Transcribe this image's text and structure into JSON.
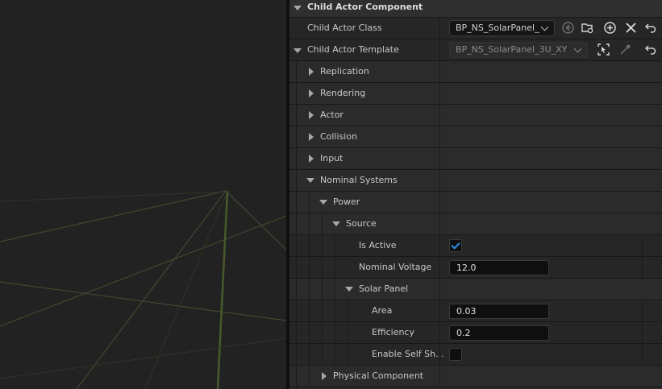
{
  "details": {
    "section_title": "Child Actor Component",
    "child_actor_class": {
      "label": "Child Actor Class",
      "value": "BP_NS_SolarPanel_"
    },
    "child_actor_template": {
      "label": "Child Actor Template",
      "value": "BP_NS_SolarPanel_3U_XY"
    },
    "categories": {
      "replication": "Replication",
      "rendering": "Rendering",
      "actor": "Actor",
      "collision": "Collision",
      "input": "Input",
      "nominal_systems": "Nominal Systems",
      "physical_component": "Physical Component"
    },
    "power": {
      "label": "Power",
      "source": {
        "label": "Source",
        "is_active_label": "Is Active",
        "is_active": true,
        "nominal_voltage_label": "Nominal Voltage",
        "nominal_voltage": "12.0",
        "solar_panel": {
          "label": "Solar Panel",
          "area_label": "Area",
          "area": "0.03",
          "efficiency_label": "Efficiency",
          "efficiency": "0.2",
          "self_shadow_label": "Enable Self Sh...",
          "self_shadow": false
        }
      }
    }
  },
  "colors": {
    "accent": "#2b8fe6",
    "panel_bg": "#242424",
    "viewport_bg": "#222222",
    "grid_line": "#4a5a2e"
  },
  "icons": {
    "use_selected": "arrow-left-circle-icon",
    "browse": "folder-search-icon",
    "add": "plus-circle-icon",
    "clear": "close-icon",
    "reset": "reset-arrow-icon",
    "select": "select-actor-icon",
    "pick": "eyedropper-icon"
  }
}
